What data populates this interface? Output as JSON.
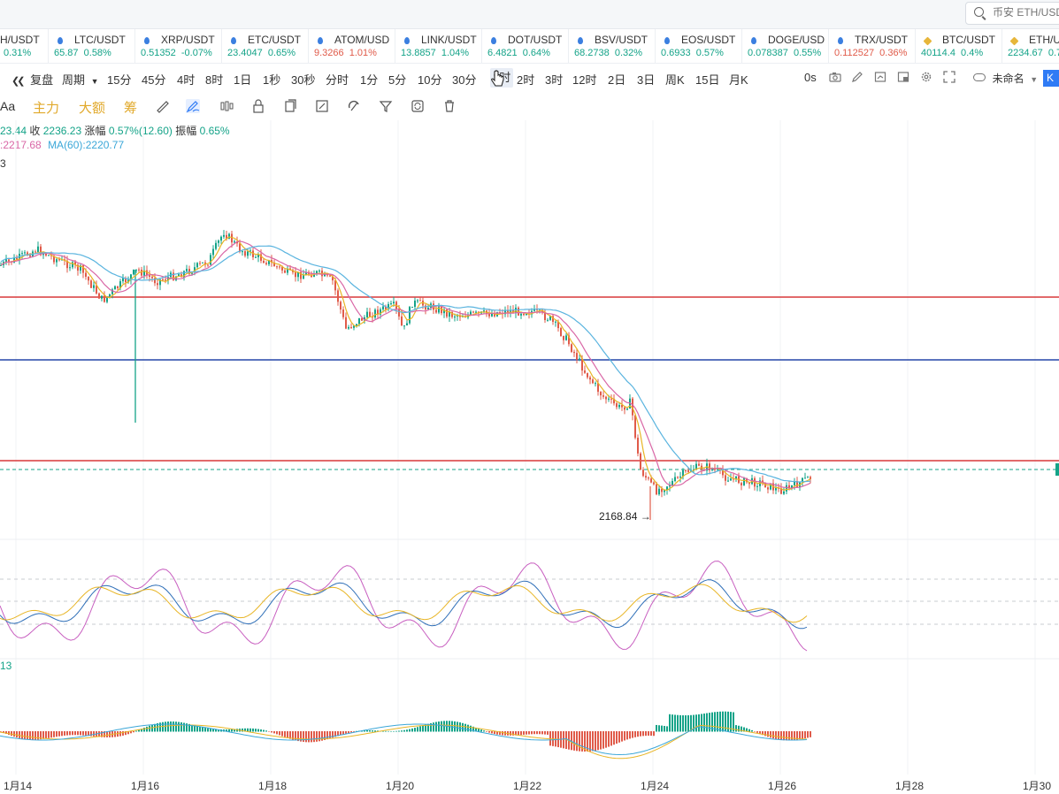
{
  "search": {
    "placeholder": "币安 ETH/USD"
  },
  "tickers": [
    {
      "symbol": "H/USDT",
      "price": "",
      "change": "0.31%",
      "dir": "up",
      "icon": "none"
    },
    {
      "symbol": "LTC/USDT",
      "price": "65.87",
      "change": "0.58%",
      "dir": "up",
      "icon": "drop-icon"
    },
    {
      "symbol": "XRP/USDT",
      "price": "0.51352",
      "change": "-0.07%",
      "dir": "up",
      "icon": "drop-icon"
    },
    {
      "symbol": "ETC/USDT",
      "price": "23.4047",
      "change": "0.65%",
      "dir": "up",
      "icon": "drop-icon"
    },
    {
      "symbol": "ATOM/USD",
      "price": "9.3266",
      "change": "1.01%",
      "dir": "dn",
      "icon": "drop-icon"
    },
    {
      "symbol": "LINK/USDT",
      "price": "13.8857",
      "change": "1.04%",
      "dir": "up",
      "icon": "drop-icon"
    },
    {
      "symbol": "DOT/USDT",
      "price": "6.4821",
      "change": "0.64%",
      "dir": "up",
      "icon": "drop-icon"
    },
    {
      "symbol": "BSV/USDT",
      "price": "68.2738",
      "change": "0.32%",
      "dir": "up",
      "icon": "drop-icon"
    },
    {
      "symbol": "EOS/USDT",
      "price": "0.6933",
      "change": "0.57%",
      "dir": "up",
      "icon": "drop-icon"
    },
    {
      "symbol": "DOGE/USD",
      "price": "0.078387",
      "change": "0.55%",
      "dir": "up",
      "icon": "drop-icon"
    },
    {
      "symbol": "TRX/USDT",
      "price": "0.112527",
      "change": "0.36%",
      "dir": "dn",
      "icon": "drop-icon"
    },
    {
      "symbol": "BTC/USDT",
      "price": "40114.4",
      "change": "0.4%",
      "dir": "up",
      "icon": "diamond-icon"
    },
    {
      "symbol": "ETH/USD",
      "price": "2234.67",
      "change": "0.7",
      "dir": "up",
      "icon": "diamond-icon"
    }
  ],
  "toolbar": {
    "restore": "复盘",
    "period": "周期",
    "intervals": [
      "15分",
      "45分",
      "4时",
      "8时",
      "1日",
      "1秒",
      "30秒",
      "分时",
      "1分",
      "5分",
      "10分",
      "30分",
      "1时",
      "2时",
      "3时",
      "12时",
      "2日",
      "3日",
      "周K",
      "15日",
      "月K"
    ],
    "selected_interval": "1时",
    "countdown": "0s",
    "layout_name": "未命名",
    "ktag": "K线"
  },
  "drawbar": {
    "font": "Aa",
    "main": "主力",
    "large": "大额",
    "chips": "筹"
  },
  "legend": {
    "ohlc_prefix": "23.44",
    "close_label": "收",
    "close_value": "2236.23",
    "change_label": "涨幅",
    "change_value": "0.57%(12.60)",
    "amp_label": "振幅",
    "amp_value": "0.65%",
    "ma_partial": ":2217.68",
    "ma60": "MA(60):2220.77",
    "line3": "3"
  },
  "kdj_label": "13",
  "low_label": "2168.84",
  "x_labels": [
    "1月14",
    "1月16",
    "1月18",
    "1月20",
    "1月22",
    "1月24",
    "1月26",
    "1月28",
    "1月30"
  ],
  "colors": {
    "up": "#14a388",
    "down": "#e05b4a",
    "red_line": "#d9383a",
    "blue_line": "#2546a8",
    "ma_yellow": "#e8b525",
    "ma_pink": "#d967a6",
    "ma_blue": "#5ab4df"
  }
}
